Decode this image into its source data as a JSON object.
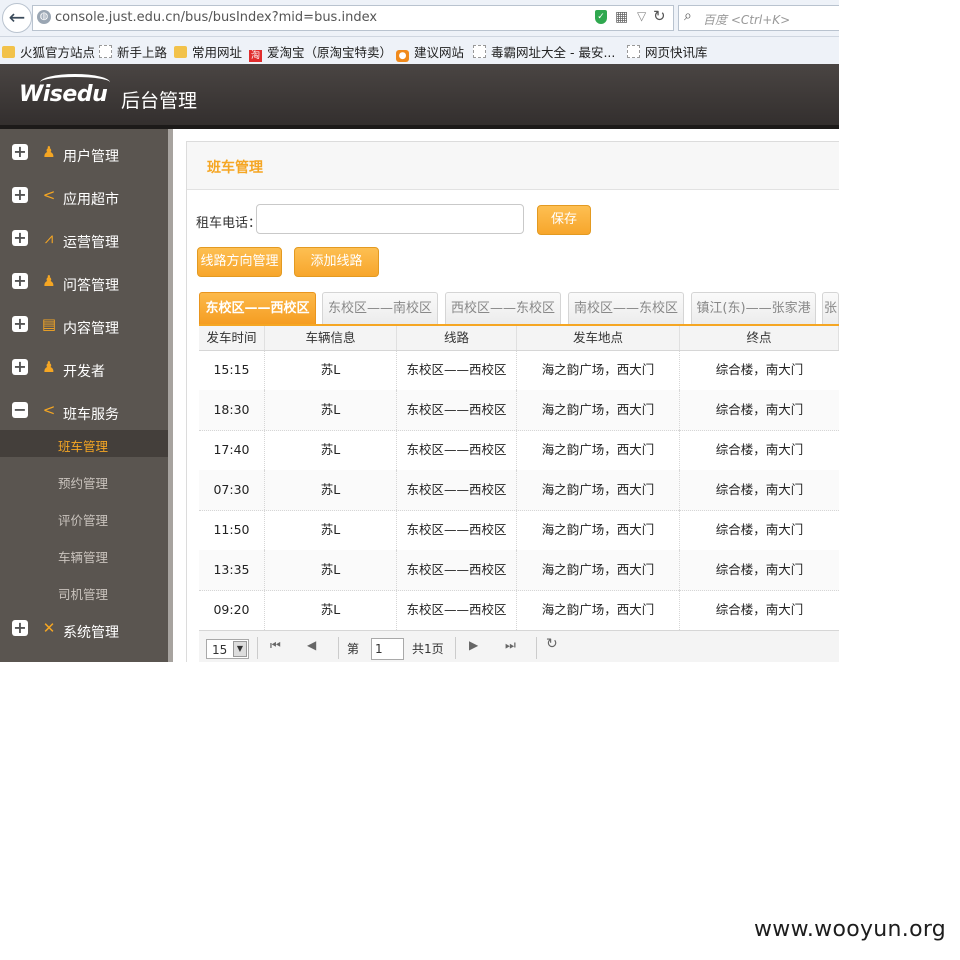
{
  "browser": {
    "url": "console.just.edu.cn/bus/busIndex?mid=bus.index",
    "search_placeholder": "百度 <Ctrl+K>",
    "bookmarks": [
      "火狐官方站点",
      "新手上路",
      "常用网址",
      "爱淘宝（原淘宝特卖）",
      "建议网站",
      "毒霸网址大全 - 最安...",
      "网页快讯库"
    ]
  },
  "header": {
    "logo": "Wisedu",
    "title": "后台管理"
  },
  "sidebar": {
    "items": [
      {
        "label": "用户管理",
        "icon": "user-icon"
      },
      {
        "label": "应用超市",
        "icon": "share-icon"
      },
      {
        "label": "运营管理",
        "icon": "chart-icon"
      },
      {
        "label": "问答管理",
        "icon": "user-icon"
      },
      {
        "label": "内容管理",
        "icon": "document-icon"
      },
      {
        "label": "开发者",
        "icon": "user-icon"
      },
      {
        "label": "班车服务",
        "icon": "share-icon",
        "expanded": true
      },
      {
        "label": "系统管理",
        "icon": "tools-icon"
      }
    ],
    "sub_items": [
      "班车管理",
      "预约管理",
      "评价管理",
      "车辆管理",
      "司机管理"
    ],
    "active_sub": "班车管理"
  },
  "panel": {
    "title": "班车管理",
    "phone_label": "租车电话：",
    "phone_value": "",
    "save_label": "保存",
    "route_dir_label": "线路方向管理",
    "add_route_label": "添加线路"
  },
  "tabs": [
    "东校区——西校区",
    "东校区——南校区",
    "西校区——东校区",
    "南校区——东校区",
    "镇江(东)——张家港",
    "张"
  ],
  "active_tab": 0,
  "table": {
    "columns": [
      "发车时间",
      "车辆信息",
      "线路",
      "发车地点",
      "终点"
    ],
    "rows": [
      [
        "15:15",
        "苏L",
        "东校区——西校区",
        "海之韵广场，西大门",
        "综合楼，南大门"
      ],
      [
        "18:30",
        "苏L",
        "东校区——西校区",
        "海之韵广场，西大门",
        "综合楼，南大门"
      ],
      [
        "17:40",
        "苏L",
        "东校区——西校区",
        "海之韵广场，西大门",
        "综合楼，南大门"
      ],
      [
        "07:30",
        "苏L",
        "东校区——西校区",
        "海之韵广场，西大门",
        "综合楼，南大门"
      ],
      [
        "11:50",
        "苏L",
        "东校区——西校区",
        "海之韵广场，西大门",
        "综合楼，南大门"
      ],
      [
        "13:35",
        "苏L",
        "东校区——西校区",
        "海之韵广场，西大门",
        "综合楼，南大门"
      ],
      [
        "09:20",
        "苏L",
        "东校区——西校区",
        "海之韵广场，西大门",
        "综合楼，南大门"
      ]
    ]
  },
  "pager": {
    "page_size": "15",
    "page_label": "第",
    "page_number": "1",
    "total_label": "共1页"
  },
  "colors": {
    "accent": "#f5a623",
    "sidebar": "#5a5550",
    "header": "#3d3937"
  },
  "watermark": "www.wooyun.org"
}
